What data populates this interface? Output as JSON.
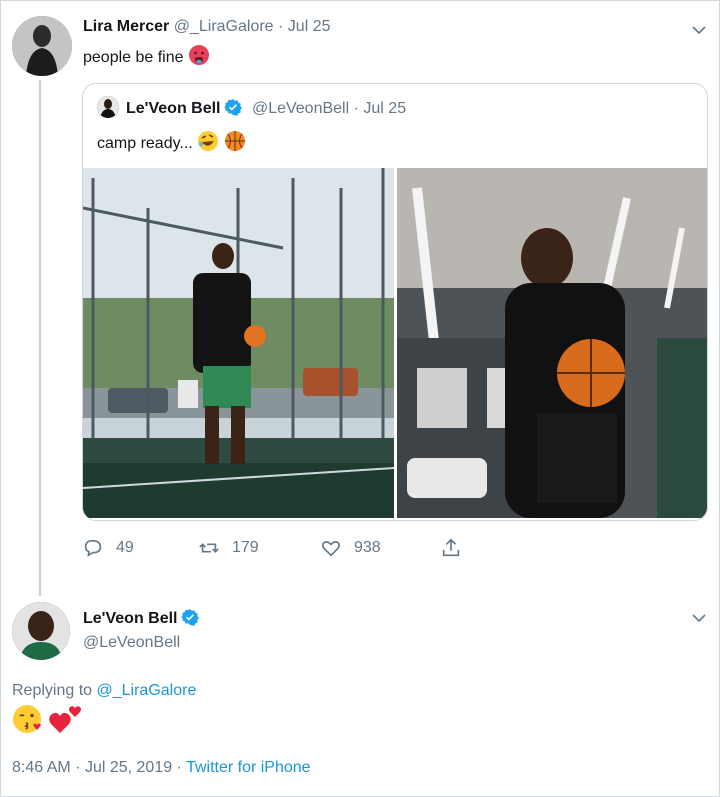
{
  "tweet1": {
    "name": "Lira Mercer",
    "handle": "@_LiraGalore",
    "separator": "·",
    "date": "Jul 25",
    "text": "people be fine",
    "emoji": "hot-face-emoji"
  },
  "quoted": {
    "name": "Le'Veon Bell",
    "handle": "@LeVeonBell",
    "separator": "·",
    "date": "Jul 25",
    "text": "camp ready...",
    "emojis": [
      "rolling-laughing-emoji",
      "basketball-emoji"
    ],
    "photos": [
      "player-walking-photo",
      "player-locker-room-photo"
    ]
  },
  "actions": {
    "replies": "49",
    "retweets": "179",
    "likes": "938"
  },
  "tweet2": {
    "name": "Le'Veon Bell",
    "handle": "@LeVeonBell",
    "replying_label": "Replying to",
    "replying_to": "@_LiraGalore",
    "emojis": [
      "kissing-face-emoji",
      "two-hearts-emoji"
    ],
    "time": "8:46 AM",
    "separator": "·",
    "date": "Jul 25, 2019",
    "source": "Twitter for iPhone"
  },
  "colors": {
    "link": "#1b95e0",
    "muted": "#657786",
    "verified": "#1da1f2"
  }
}
